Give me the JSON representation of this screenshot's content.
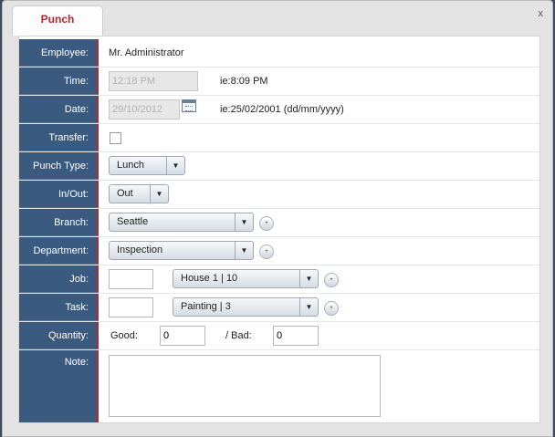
{
  "window": {
    "tab_label": "Punch",
    "close_label": "x"
  },
  "form": {
    "employee": {
      "label": "Employee:",
      "value": "Mr. Administrator"
    },
    "time": {
      "label": "Time:",
      "value": "12:18 PM",
      "hint": "ie:8:09 PM"
    },
    "date": {
      "label": "Date:",
      "value": "29/10/2012",
      "hint": "ie:25/02/2001 (dd/mm/yyyy)",
      "calendar_icon": "calendar-icon"
    },
    "transfer": {
      "label": "Transfer:",
      "checked": false
    },
    "punch_type": {
      "label": "Punch Type:",
      "selected": "Lunch"
    },
    "in_out": {
      "label": "In/Out:",
      "selected": "Out"
    },
    "branch": {
      "label": "Branch:",
      "selected": "Seattle"
    },
    "department": {
      "label": "Department:",
      "selected": "Inspection"
    },
    "job": {
      "label": "Job:",
      "code": "",
      "selected": "House 1 | 10"
    },
    "task": {
      "label": "Task:",
      "code": "",
      "selected": "Painting | 3"
    },
    "quantity": {
      "label": "Quantity:",
      "good_label": "Good:",
      "good_value": "0",
      "bad_label": "/ Bad:",
      "bad_value": "0"
    },
    "note": {
      "label": "Note:",
      "value": ""
    }
  },
  "colors": {
    "label_column": "#3b5a80",
    "accent": "#b5282e",
    "background": "#e3e3e3"
  }
}
